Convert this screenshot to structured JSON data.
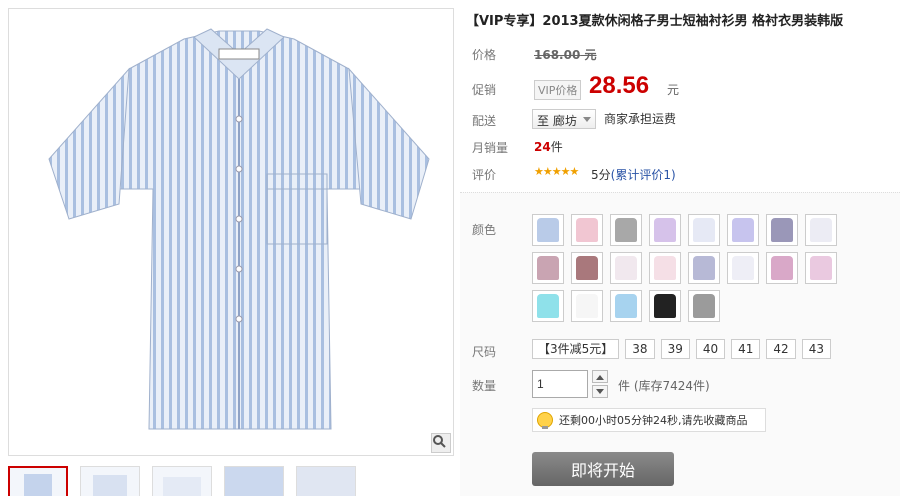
{
  "product": {
    "title": "【VIP专享】2013夏款休闲格子男士短袖衬衫男 格衬衣男装韩版"
  },
  "labels": {
    "price": "价格",
    "promo": "促销",
    "shipping": "配送",
    "monthly_sales": "月销量",
    "rating": "评价",
    "color": "颜色",
    "size": "尺码",
    "quantity": "数量"
  },
  "pricing": {
    "original": "168.00",
    "currency_unit": "元",
    "vip_tag": "VIP价格",
    "promo_price": "28.56"
  },
  "shipping": {
    "destination": "至 廊坊",
    "note": "商家承担运费"
  },
  "sales": {
    "count": "24",
    "unit": "件"
  },
  "rating": {
    "stars": "★★★★★",
    "score_text": "5分",
    "review_link": "(累计评价1)"
  },
  "colors": [
    {
      "swatch": "#b9cbe8"
    },
    {
      "swatch": "#f1c6d2"
    },
    {
      "swatch": "#a8a8a8"
    },
    {
      "swatch": "#d6c2ea"
    },
    {
      "swatch": "#e6e9f5"
    },
    {
      "swatch": "#c7c4ee"
    },
    {
      "swatch": "#9a97b8"
    },
    {
      "swatch": "#ececf4"
    },
    {
      "swatch": "#c9a4b2"
    },
    {
      "swatch": "#a9787c"
    },
    {
      "swatch": "#f1e8ee"
    },
    {
      "swatch": "#f5dfe6"
    },
    {
      "swatch": "#b7b9d6"
    },
    {
      "swatch": "#eeeef6"
    },
    {
      "swatch": "#d9a8c8"
    },
    {
      "swatch": "#eac9e0"
    },
    {
      "swatch": "#8fe1ea"
    },
    {
      "swatch": "#f6f6f6"
    },
    {
      "swatch": "#a7d3ef"
    },
    {
      "swatch": "#222222"
    },
    {
      "swatch": "#9b9b9b"
    }
  ],
  "sizes": [
    "【3件减5元】",
    "38",
    "39",
    "40",
    "41",
    "42",
    "43"
  ],
  "quantity": {
    "value": "1",
    "stock": "件 (库存7424件)"
  },
  "notice": "还剩00小时05分钟24秒,请先收藏商品",
  "actions": {
    "start": "即将开始"
  }
}
